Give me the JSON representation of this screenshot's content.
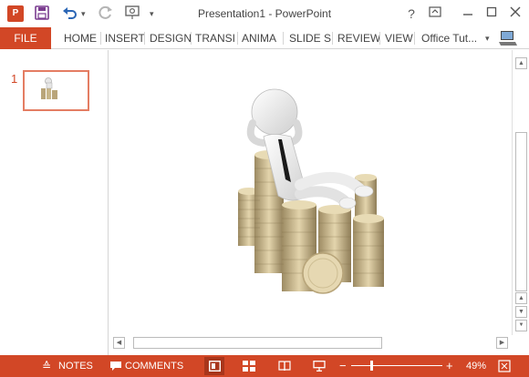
{
  "window": {
    "title": "Presentation1 - PowerPoint",
    "app_logo_text": "P",
    "help_label": "?"
  },
  "ribbon": {
    "file_label": "FILE",
    "tabs": [
      "HOME",
      "INSERT",
      "DESIGN",
      "TRANSI",
      "ANIMA",
      "SLIDE S",
      "REVIEW",
      "VIEW"
    ],
    "account_name": "Office Tut..."
  },
  "thumbnails": {
    "slides": [
      {
        "number": "1"
      }
    ]
  },
  "statusbar": {
    "notes_label": "NOTES",
    "comments_label": "COMMENTS",
    "zoom_minus": "−",
    "zoom_plus": "+",
    "zoom_level": "49%",
    "zoom_value_fraction": 0.49
  },
  "colors": {
    "accent": "#d24726",
    "accent_dark": "#a8361c",
    "thumb_border": "#e47d63"
  },
  "icons": {
    "save": "save-icon",
    "undo": "undo-icon",
    "redo": "redo-icon",
    "start_from_beginning": "presentation-start-icon",
    "customize_qat": "chevron-down-icon",
    "help": "help-icon",
    "ribbon_display": "ribbon-display-options-icon",
    "minimize": "minimize-icon",
    "restore": "restore-icon",
    "close": "close-icon",
    "notes": "notes-icon",
    "comments": "comment-icon",
    "normal_view": "normal-view-icon",
    "slide_sorter": "slide-sorter-icon",
    "reading_view": "reading-view-icon",
    "slide_show": "slide-show-icon",
    "fit_to_window": "fit-to-window-icon"
  }
}
